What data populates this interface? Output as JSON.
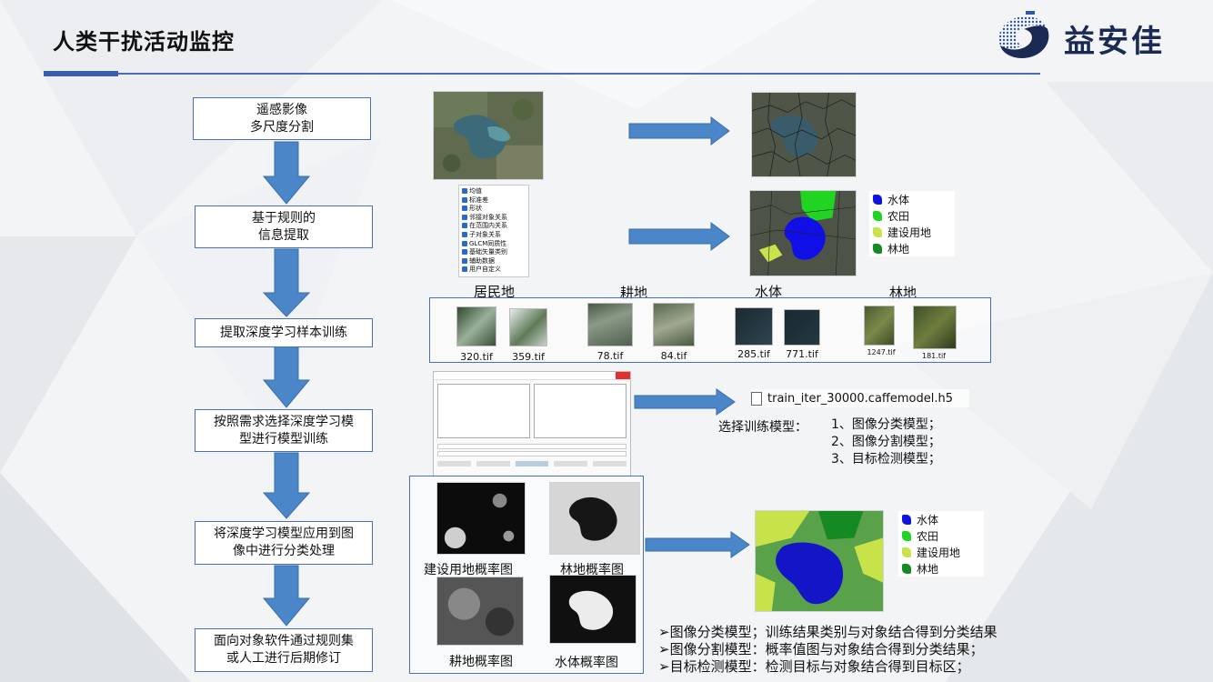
{
  "header": {
    "title": "人类干扰活动监控",
    "logo_text": "益安佳"
  },
  "steps": [
    {
      "lines": [
        "遥感影像",
        "多尺度分割"
      ]
    },
    {
      "lines": [
        "基于规则的",
        "信息提取"
      ]
    },
    {
      "lines": [
        "提取深度学习样本训练"
      ]
    },
    {
      "lines": [
        "按照需求选择深度学习模",
        "型进行模型训练"
      ]
    },
    {
      "lines": [
        "将深度学习模型应用到图",
        "像中进行分类处理"
      ]
    },
    {
      "lines": [
        "面向对象软件通过规则集",
        "或人工进行后期修订"
      ]
    }
  ],
  "feature_tree": {
    "items": [
      "均值",
      "标准差",
      "形状",
      "邻接对象关系",
      "在范围内关系",
      "子对象关系",
      "GLCM同质性",
      "基础矢量类别",
      "辅助数据",
      "用户自定义"
    ]
  },
  "legend": {
    "items": [
      {
        "label": "水体",
        "color": "#1010e6"
      },
      {
        "label": "农田",
        "color": "#22d422"
      },
      {
        "label": "建设用地",
        "color": "#c8e34a"
      },
      {
        "label": "林地",
        "color": "#168a22"
      }
    ]
  },
  "samples": {
    "classes": [
      "居民地",
      "耕地",
      "水体",
      "林地"
    ],
    "files": [
      "320.tif",
      "359.tif",
      "78.tif",
      "84.tif",
      "285.tif",
      "771.tif",
      "1247.tif",
      "181.tif"
    ]
  },
  "model": {
    "file_name": "train_iter_30000.caffemodel.h5",
    "choose_label": "选择训练模型：",
    "options": [
      "1、图像分类模型；",
      "2、图像分割模型；",
      "3、目标检测模型；"
    ]
  },
  "probability_maps": {
    "captions": [
      "建设用地概率图",
      "林地概率图",
      "耕地概率图",
      "水体概率图"
    ]
  },
  "notes": [
    "➢图像分类模型；训练结果类别与对象结合得到分类结果",
    "➢图像分割模型：概率值图与对象结合得到分类结果；",
    "➢目标检测模型：检测目标与对象结合得到目标区；"
  ]
}
